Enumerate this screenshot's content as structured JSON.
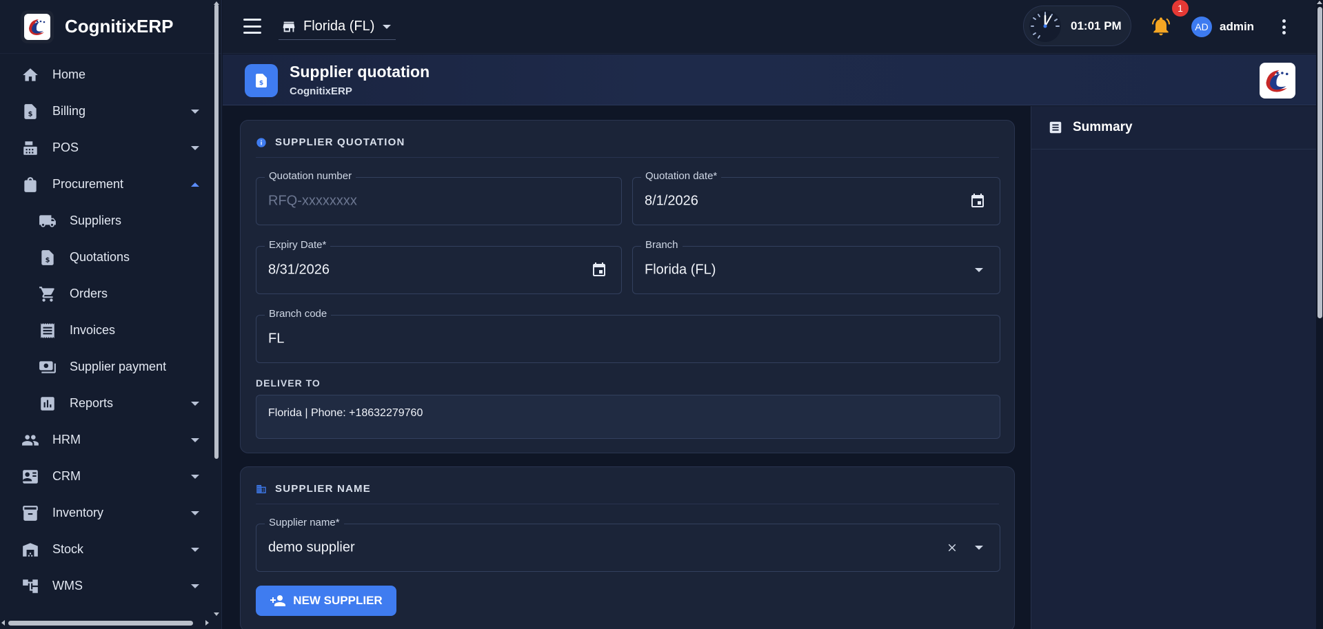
{
  "app": {
    "name": "CognitixERP"
  },
  "sidebar": {
    "items": [
      {
        "label": "Home",
        "icon": "home-icon"
      },
      {
        "label": "Billing",
        "icon": "billing-icon"
      },
      {
        "label": "POS",
        "icon": "pos-icon"
      },
      {
        "label": "Procurement",
        "icon": "shopping-bag-icon",
        "expanded": true
      },
      {
        "label": "Suppliers",
        "icon": "truck-icon"
      },
      {
        "label": "Quotations",
        "icon": "quotation-icon"
      },
      {
        "label": "Orders",
        "icon": "cart-icon"
      },
      {
        "label": "Invoices",
        "icon": "receipt-icon"
      },
      {
        "label": "Supplier payment",
        "icon": "payment-icon"
      },
      {
        "label": "Reports",
        "icon": "bar-chart-icon"
      },
      {
        "label": "HRM",
        "icon": "people-icon"
      },
      {
        "label": "CRM",
        "icon": "contact-card-icon"
      },
      {
        "label": "Inventory",
        "icon": "archive-icon"
      },
      {
        "label": "Stock",
        "icon": "warehouse-icon"
      },
      {
        "label": "WMS",
        "icon": "hierarchy-icon"
      }
    ]
  },
  "topbar": {
    "branch": "Florida (FL)",
    "time": "01:01 PM",
    "notification_count": "1",
    "avatar_initials": "AD",
    "username": "admin"
  },
  "page_header": {
    "title": "Supplier quotation",
    "subtitle": "CognitixERP"
  },
  "quotation_section": {
    "title": "SUPPLIER QUOTATION",
    "quotation_number": {
      "label": "Quotation number",
      "placeholder": "RFQ-xxxxxxxx"
    },
    "quotation_date": {
      "label": "Quotation date*",
      "value": "8/1/2026"
    },
    "expiry_date": {
      "label": "Expiry Date*",
      "value": "8/31/2026"
    },
    "branch": {
      "label": "Branch",
      "value": "Florida (FL)"
    },
    "branch_code": {
      "label": "Branch code",
      "value": "FL"
    },
    "deliver_to": {
      "label": "DELIVER TO",
      "value": "Florida | Phone: +18632279760"
    }
  },
  "supplier_section": {
    "title": "SUPPLIER NAME",
    "supplier_name": {
      "label": "Supplier name*",
      "value": "demo supplier"
    },
    "new_supplier_label": "NEW SUPPLIER"
  },
  "summary": {
    "title": "Summary"
  },
  "colors": {
    "accent": "#3f7cf0",
    "background": "#0f1626",
    "card": "#1b2438",
    "badge": "#e53935",
    "bell": "#f5a623"
  }
}
